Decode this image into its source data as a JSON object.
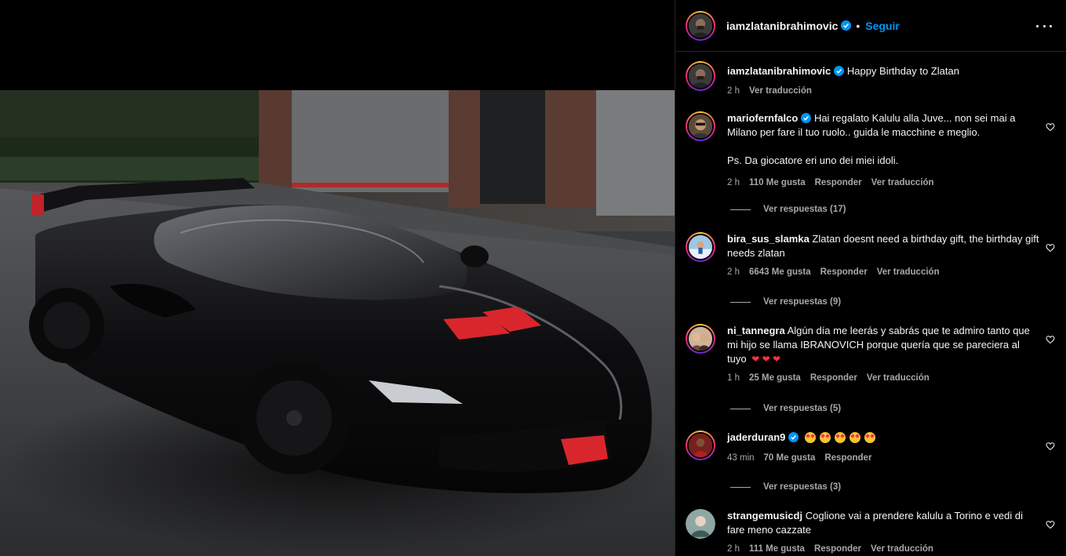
{
  "header": {
    "username": "iamzlatanibrahimovic",
    "separator": "•",
    "follow_label": "Seguir"
  },
  "caption": {
    "username": "iamzlatanibrahimovic",
    "text": "Happy Birthday to Zlatan",
    "time": "2 h",
    "translate": "Ver traducción"
  },
  "comments": [
    {
      "username": "mariofernfalco",
      "verified": true,
      "text": "Hai regalato Kalulu alla Juve... non sei mai a Milano per fare il tuo ruolo.. guida le macchine e meglio.",
      "text2": "Ps. Da giocatore eri uno dei miei idoli.",
      "time": "2 h",
      "likes": "110 Me gusta",
      "reply": "Responder",
      "translate": "Ver traducción",
      "view_replies": "Ver respuestas (17)"
    },
    {
      "username": "bira_sus_slamka",
      "verified": false,
      "text": "Zlatan doesnt need a birthday gift, the birthday gift needs zlatan",
      "time": "2 h",
      "likes": "6643 Me gusta",
      "reply": "Responder",
      "translate": "Ver traducción",
      "view_replies": "Ver respuestas (9)"
    },
    {
      "username": "ni_tannegra",
      "verified": false,
      "text": "Algún día me leerás y sabrás que te admiro tanto que mi hijo se llama IBRANOVICH porque quería que se pareciera al tuyo",
      "hearts": "❤ ❤ ❤",
      "time": "1 h",
      "likes": "25 Me gusta",
      "reply": "Responder",
      "translate": "Ver traducción",
      "view_replies": "Ver respuestas (5)"
    },
    {
      "username": "jaderduran9",
      "verified": true,
      "emoji_icon": "heart-eyes-emoji-icon",
      "time": "43 min",
      "likes": "70 Me gusta",
      "reply": "Responder",
      "view_replies": "Ver respuestas (3)"
    },
    {
      "username": "strangemusicdj",
      "verified": false,
      "text": "Coglione vai a prendere kalulu a Torino e vedi di fare meno cazzate",
      "time": "2 h",
      "likes": "111 Me gusta",
      "reply": "Responder",
      "translate": "Ver traducción"
    }
  ],
  "colors": {
    "background": "#000000",
    "accent": "#0095f6",
    "verified": "#0095f6",
    "muted_text": "#a8a8a8",
    "car_accent": "#e0242a"
  }
}
